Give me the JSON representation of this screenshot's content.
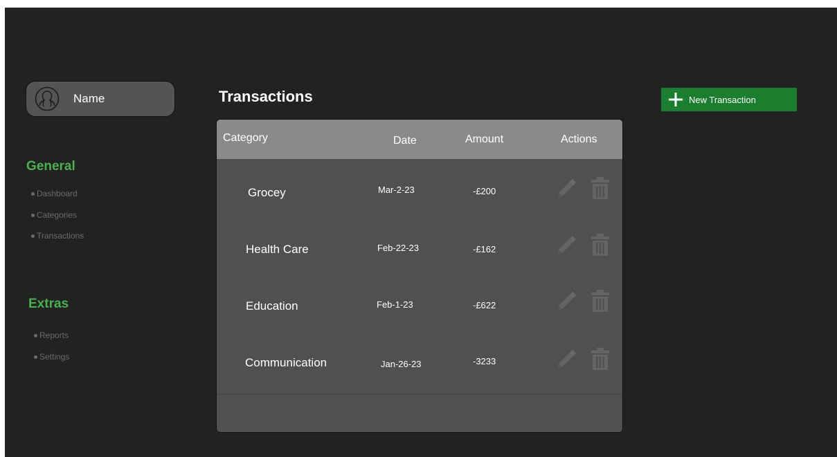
{
  "profile": {
    "name": "Name",
    "icon": "user-icon"
  },
  "nav": {
    "general": {
      "heading": "General",
      "items": [
        "Dashboard",
        "Categories",
        "Transactions"
      ]
    },
    "extras": {
      "heading": "Extras",
      "items": [
        "Reports",
        "Settings"
      ]
    }
  },
  "page": {
    "title": "Transactions"
  },
  "new_button": {
    "label": "New Transaction",
    "icon": "plus-icon"
  },
  "table": {
    "headers": {
      "category": "Category",
      "date": "Date",
      "amount": "Amount",
      "actions": "Actions"
    },
    "rows": [
      {
        "category": "Grocey",
        "date": "Mar-2-23",
        "amount": "-£200"
      },
      {
        "category": "Health Care",
        "date": "Feb-22-23",
        "amount": "-£162"
      },
      {
        "category": "Education",
        "date": "Feb-1-23",
        "amount": "-£622"
      },
      {
        "category": "Communication",
        "date": "Jan-26-23",
        "amount": "-3233"
      }
    ],
    "action_icons": [
      "pencil-icon",
      "trash-icon"
    ]
  },
  "colors": {
    "background": "#222222",
    "accent_green": "#4caf50",
    "button_green": "#1b7d2e",
    "table_body": "#505050",
    "table_header": "#8a8a8a",
    "action_icon": "#646464"
  }
}
